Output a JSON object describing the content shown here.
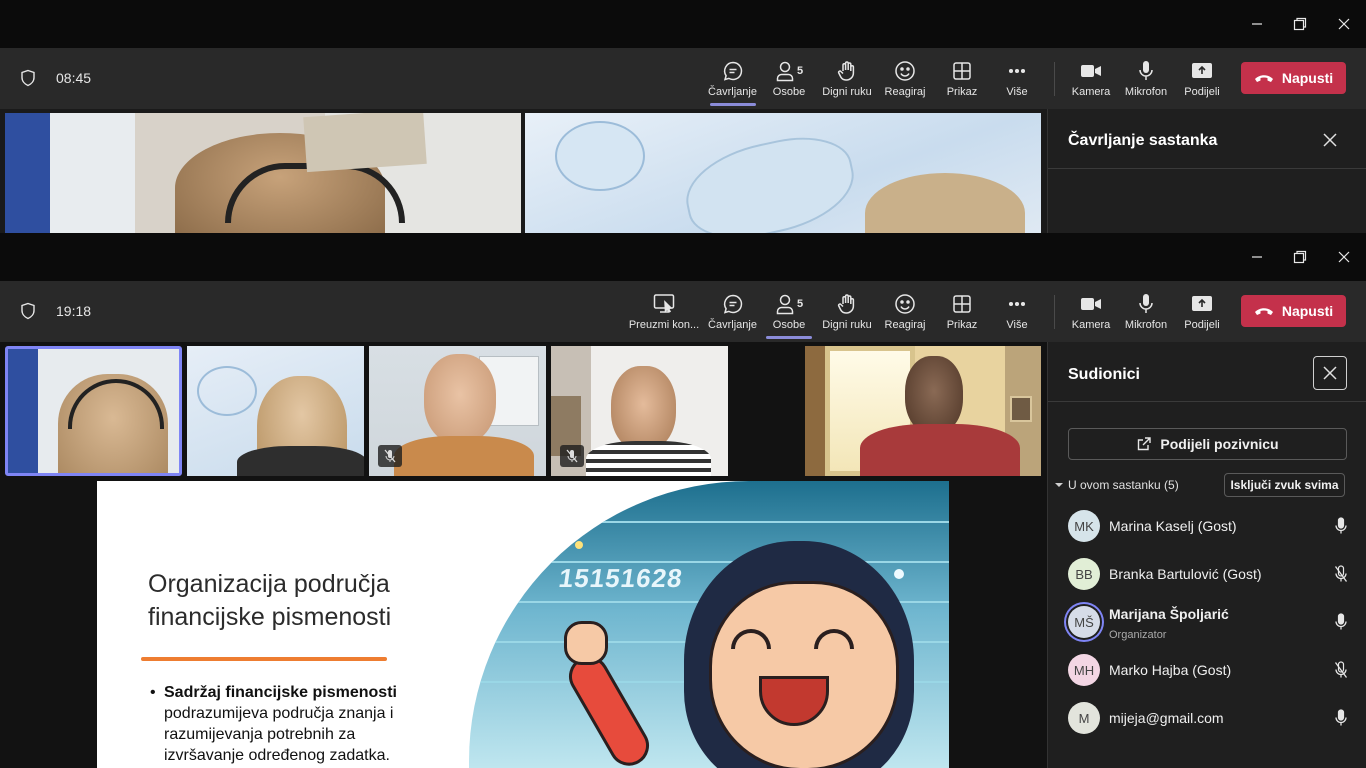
{
  "window_top": {
    "time": "08:45",
    "toolbar": {
      "chat": "Čavrljanje",
      "people": "Osobe",
      "people_count": "5",
      "raise": "Digni ruku",
      "react": "Reagiraj",
      "view": "Prikaz",
      "more": "Više",
      "camera": "Kamera",
      "mic": "Mikrofon",
      "share": "Podijeli",
      "leave": "Napusti"
    },
    "panel_title": "Čavrljanje sastanka"
  },
  "window_main": {
    "time": "19:18",
    "toolbar": {
      "take_control": "Preuzmi kon...",
      "chat": "Čavrljanje",
      "people": "Osobe",
      "people_count": "5",
      "raise": "Digni ruku",
      "react": "Reagiraj",
      "view": "Prikaz",
      "more": "Više",
      "camera": "Kamera",
      "mic": "Mikrofon",
      "share": "Podijeli",
      "leave": "Napusti"
    },
    "panel": {
      "title": "Sudionici",
      "invite_button": "Podijeli pozivnicu",
      "section_label": "U ovom sastanku (5)",
      "mute_all": "Isključi zvuk svima",
      "participants": [
        {
          "initials": "MK",
          "name": "Marina Kaselj (Gost)",
          "role": "",
          "muted": false,
          "color": "#d6e4ea"
        },
        {
          "initials": "BB",
          "name": "Branka Bartulović (Gost)",
          "role": "",
          "muted": true,
          "color": "#e1eed6"
        },
        {
          "initials": "MŠ",
          "name": "Marijana Špoljarić",
          "role": "Organizator",
          "muted": false,
          "color": "#d6dce8"
        },
        {
          "initials": "MH",
          "name": "Marko Hajba (Gost)",
          "role": "",
          "muted": true,
          "color": "#f3d6e4"
        },
        {
          "initials": "M",
          "name": "mijeja@gmail.com",
          "role": "",
          "muted": false,
          "color": "#e2e4dc"
        }
      ]
    },
    "slide": {
      "title_line1": "Organizacija područja",
      "title_line2": "financijske pismenosti",
      "bullet_bold": "Sadržaj financijske pismenosti",
      "bullet_line1": "podrazumijeva područja znanja i",
      "bullet_line2": "razumijevanja potrebnih za",
      "bullet_line3": "izvršavanje određenog zadatka.",
      "chart_text": "15151628"
    }
  }
}
